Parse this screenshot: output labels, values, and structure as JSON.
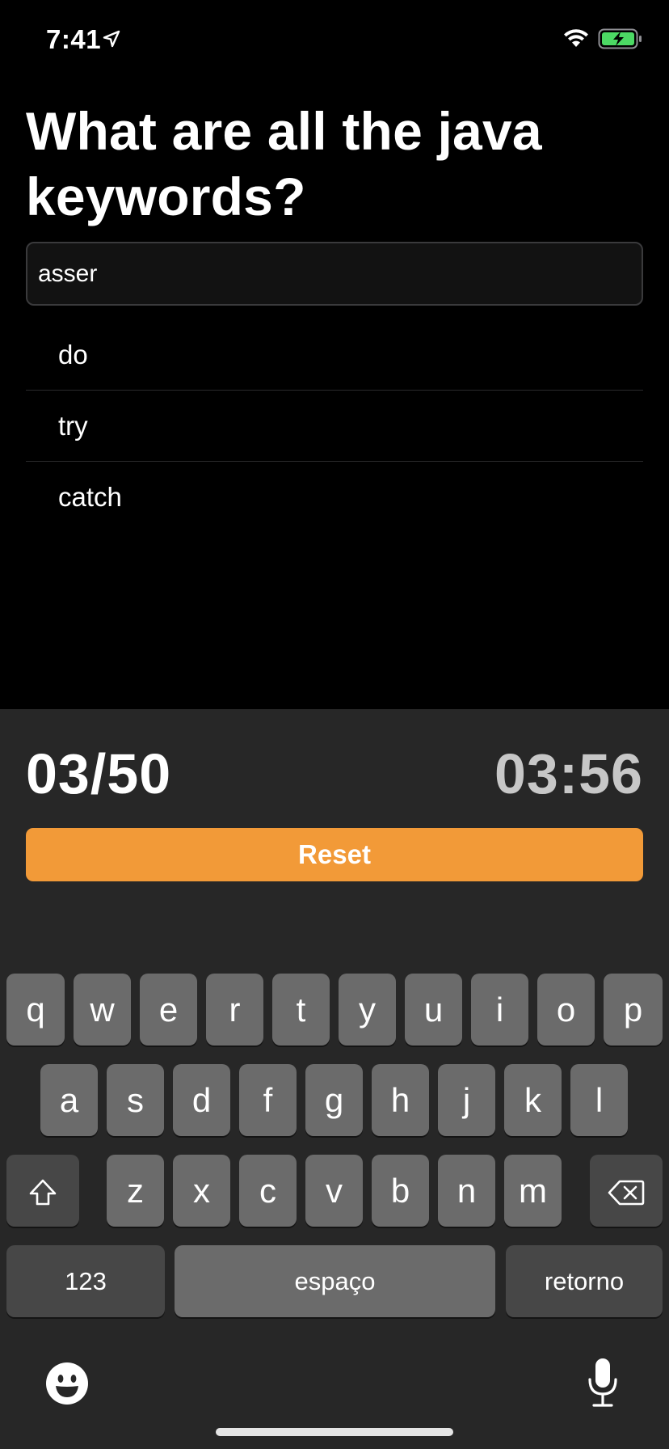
{
  "status": {
    "time": "7:41"
  },
  "question": {
    "title": "What are all the java keywords?"
  },
  "input": {
    "value": "asser"
  },
  "answers": [
    "do",
    "try",
    "catch"
  ],
  "footer": {
    "score": "03/50",
    "timer": "03:56",
    "reset_label": "Reset"
  },
  "keyboard": {
    "row1": [
      "q",
      "w",
      "e",
      "r",
      "t",
      "y",
      "u",
      "i",
      "o",
      "p"
    ],
    "row2": [
      "a",
      "s",
      "d",
      "f",
      "g",
      "h",
      "j",
      "k",
      "l"
    ],
    "row3": [
      "z",
      "x",
      "c",
      "v",
      "b",
      "n",
      "m"
    ],
    "numbers_label": "123",
    "space_label": "espaço",
    "return_label": "retorno"
  },
  "colors": {
    "accent": "#f29a38",
    "panel": "#272727",
    "key": "#6b6b6b",
    "key_dark": "#474747",
    "battery": "#4cd964"
  },
  "icons": [
    "location-arrow-icon",
    "wifi-icon",
    "battery-charging-icon",
    "shift-icon",
    "backspace-icon",
    "emoji-icon",
    "microphone-icon"
  ]
}
